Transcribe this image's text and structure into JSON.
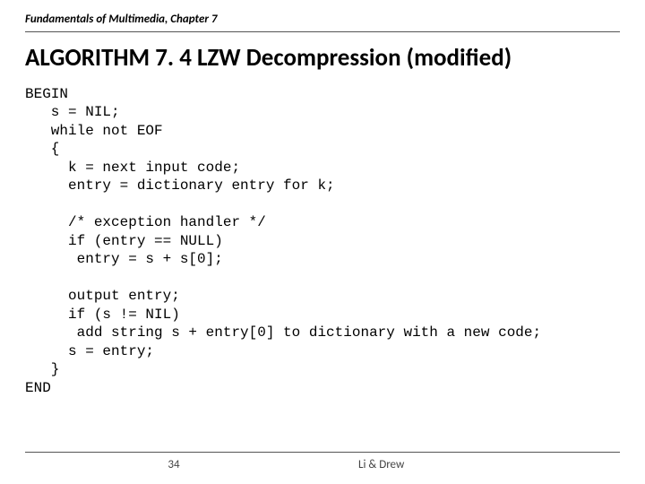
{
  "header": "Fundamentals of Multimedia, Chapter 7",
  "title": "ALGORITHM 7. 4 LZW Decompression (modified)",
  "code": "BEGIN\n   s = NIL;\n   while not EOF\n   {\n     k = next input code;\n     entry = dictionary entry for k;\n\n     /* exception handler */\n     if (entry == NULL)\n      entry = s + s[0];\n\n     output entry;\n     if (s != NIL)\n      add string s + entry[0] to dictionary with a new code;\n     s = entry;\n   }\nEND",
  "footer": {
    "page": "34",
    "authors": "Li & Drew"
  }
}
